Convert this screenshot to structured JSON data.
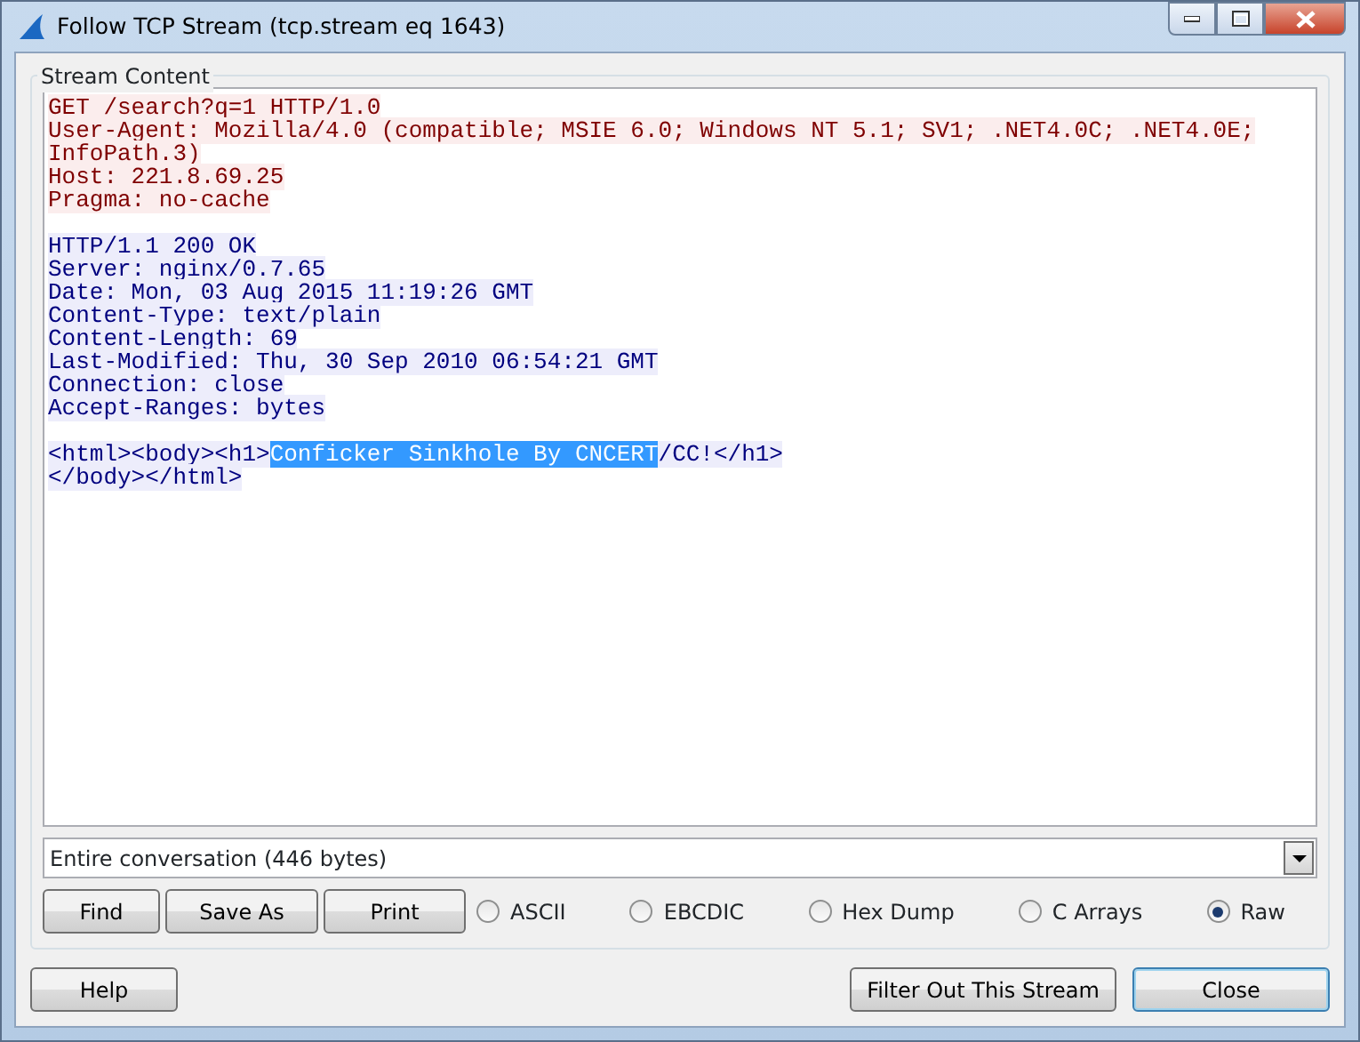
{
  "window": {
    "title": "Follow TCP Stream (tcp.stream eq 1643)"
  },
  "stream_content": {
    "title": "Stream Content",
    "blocks": [
      {
        "kind": "client",
        "lines": [
          {
            "parts": [
              {
                "text": "GET /search?q=1 HTTP/1.0",
                "selected": false
              }
            ]
          },
          {
            "parts": [
              {
                "text": "User-Agent: Mozilla/4.0 (compatible; MSIE 6.0; Windows NT 5.1; SV1; .NET4.0C; .NET4.0E;",
                "selected": false
              }
            ]
          },
          {
            "parts": [
              {
                "text": "InfoPath.3)",
                "selected": false
              }
            ]
          },
          {
            "parts": [
              {
                "text": "Host: 221.8.69.25",
                "selected": false
              }
            ]
          },
          {
            "parts": [
              {
                "text": "Pragma: no-cache",
                "selected": false
              }
            ]
          }
        ]
      },
      {
        "kind": "server",
        "lines": [
          {
            "parts": [
              {
                "text": "HTTP/1.1 200 OK",
                "selected": false
              }
            ]
          },
          {
            "parts": [
              {
                "text": "Server: nginx/0.7.65",
                "selected": false
              }
            ]
          },
          {
            "parts": [
              {
                "text": "Date: Mon, 03 Aug 2015 11:19:26 GMT",
                "selected": false
              }
            ]
          },
          {
            "parts": [
              {
                "text": "Content-Type: text/plain",
                "selected": false
              }
            ]
          },
          {
            "parts": [
              {
                "text": "Content-Length: 69",
                "selected": false
              }
            ]
          },
          {
            "parts": [
              {
                "text": "Last-Modified: Thu, 30 Sep 2010 06:54:21 GMT",
                "selected": false
              }
            ]
          },
          {
            "parts": [
              {
                "text": "Connection: close",
                "selected": false
              }
            ]
          },
          {
            "parts": [
              {
                "text": "Accept-Ranges: bytes",
                "selected": false
              }
            ]
          }
        ]
      },
      {
        "kind": "server",
        "lines": [
          {
            "parts": [
              {
                "text": "<html><body><h1>",
                "selected": false
              },
              {
                "text": "Conficker Sinkhole By CNCERT",
                "selected": true
              },
              {
                "text": "/CC!</h1>",
                "selected": false
              }
            ]
          },
          {
            "parts": [
              {
                "text": "</body></html>",
                "selected": false
              }
            ]
          }
        ]
      }
    ],
    "conversation_select": {
      "value": "Entire conversation (446 bytes)"
    },
    "buttons": [
      "Find",
      "Save As",
      "Print"
    ],
    "formats": [
      {
        "label": "ASCII",
        "selected": false
      },
      {
        "label": "EBCDIC",
        "selected": false
      },
      {
        "label": "Hex Dump",
        "selected": false
      },
      {
        "label": "C Arrays",
        "selected": false
      },
      {
        "label": "Raw",
        "selected": true
      }
    ]
  },
  "footer": {
    "help_button": "Help",
    "filter_button": "Filter Out This Stream",
    "close_button": "Close"
  }
}
